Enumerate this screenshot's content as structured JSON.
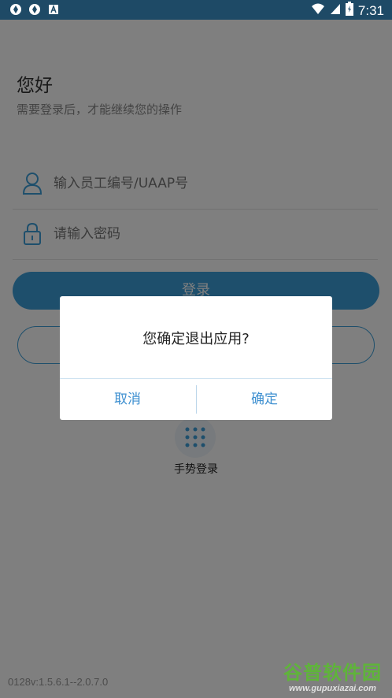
{
  "status_bar": {
    "time": "7:31",
    "left_icons": [
      "sync-icon",
      "sync-icon",
      "a-badge-icon"
    ],
    "right_icons": [
      "wifi-icon",
      "signal-icon",
      "battery-icon"
    ],
    "bg_color": "#1e4a66"
  },
  "login": {
    "greeting": "您好",
    "sub_greeting": "需要登录后，才能继续您的操作",
    "username_placeholder": "输入员工编号/UAAP号",
    "password_placeholder": "请输入密码",
    "login_button": "登录",
    "gesture_label": "手势登录",
    "version": "0128v:1.5.6.1--2.0.7.0",
    "accent_color": "#3d9fd9"
  },
  "dialog": {
    "message": "您确定退出应用?",
    "cancel_label": "取消",
    "confirm_label": "确定",
    "button_color": "#3d8fd0"
  },
  "watermark": {
    "title": "谷普软件园",
    "url": "www.gupuxiazai.com"
  }
}
